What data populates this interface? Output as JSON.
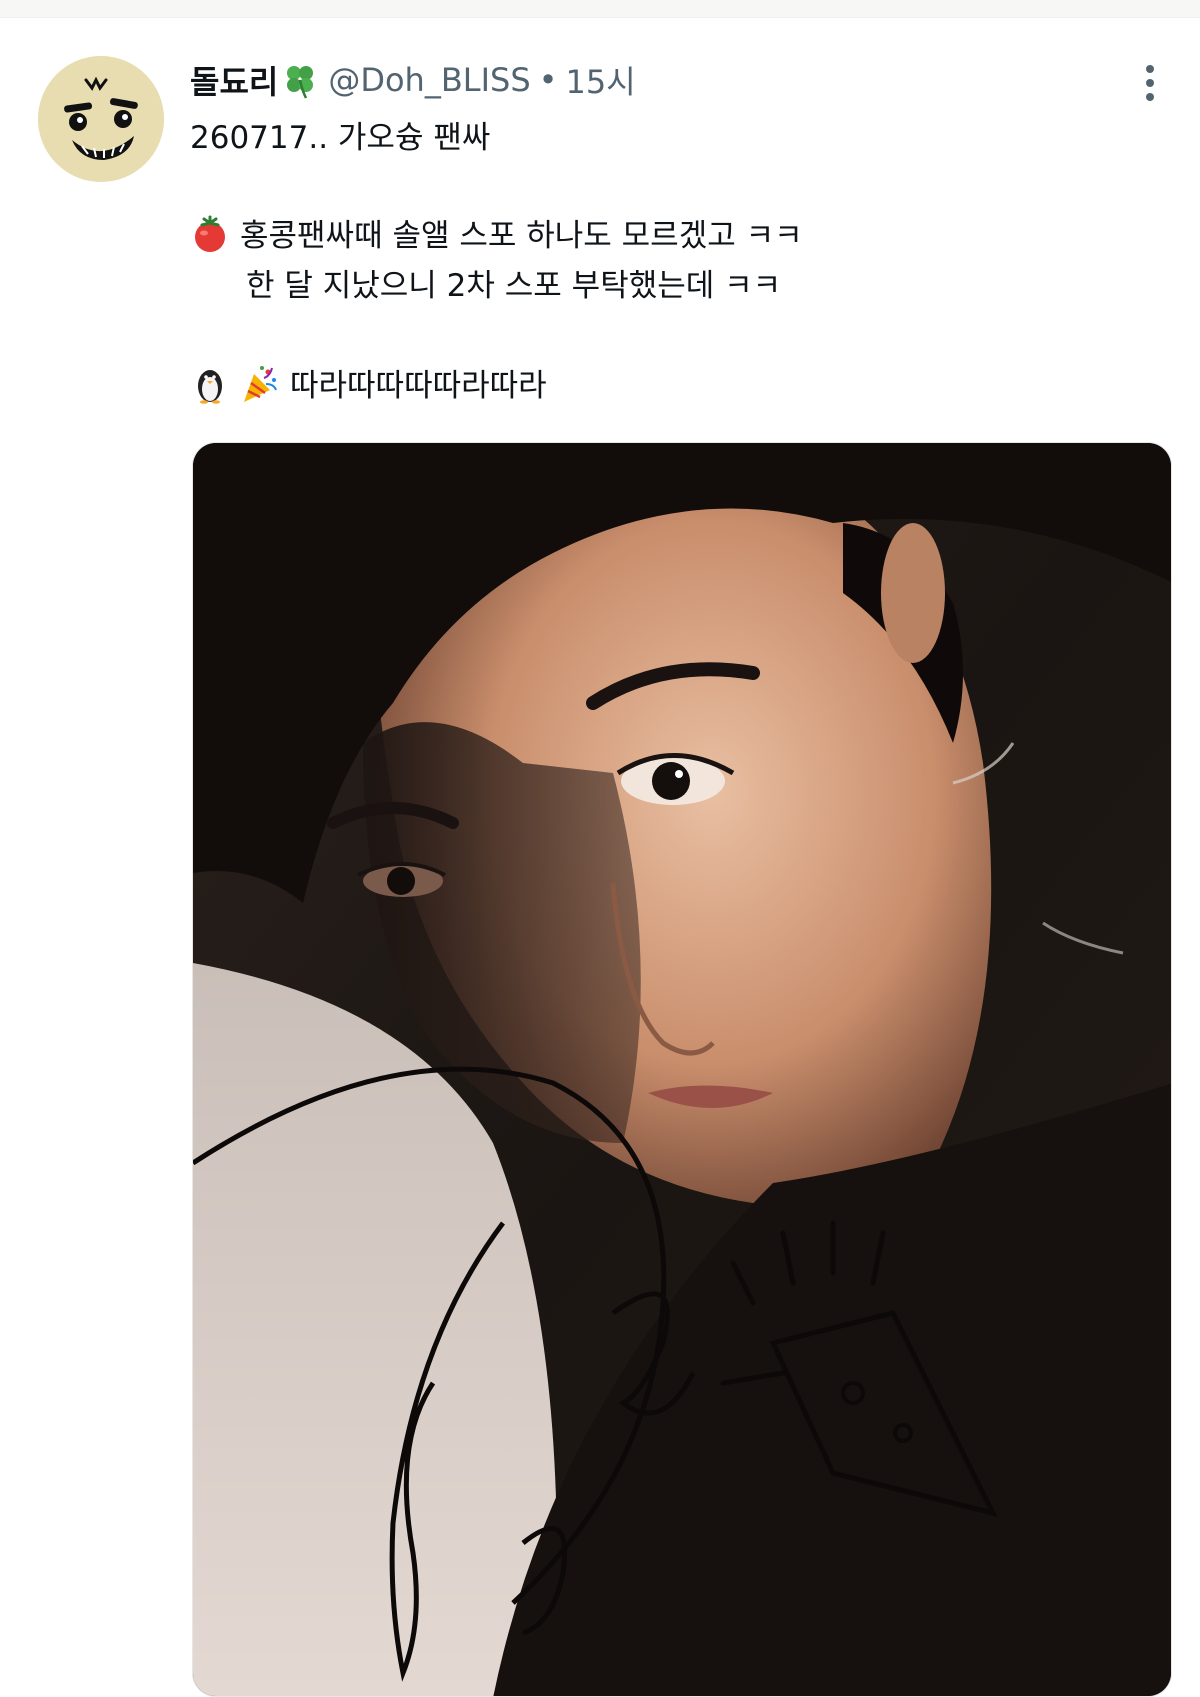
{
  "post": {
    "author": {
      "display_name": "돌됴리",
      "badge_icon": "four-leaf-clover-icon",
      "handle": "@Doh_BLISS",
      "separator": "•",
      "timestamp": "15시"
    },
    "more_icon": "more-vertical-icon",
    "lines": [
      "260717.. 가오슝 팬싸",
      "홍콩팬싸때 솔앨 스포 하나도 모르겠고 ㅋㅋ",
      "한 달 지났으니  2차 스포 부탁했는데 ㅋㅋ",
      "따라따따따따라따라"
    ],
    "line_icons": {
      "line2": "tomato-icon",
      "line4": [
        "penguin-icon",
        "party-popper-icon"
      ]
    },
    "media": {
      "type": "photo",
      "description_icon": "signed-photocard-image"
    }
  },
  "colors": {
    "text_primary": "#0f1419",
    "text_secondary": "#536471",
    "background": "#ffffff",
    "avatar_bg": "#e8ddb0"
  }
}
